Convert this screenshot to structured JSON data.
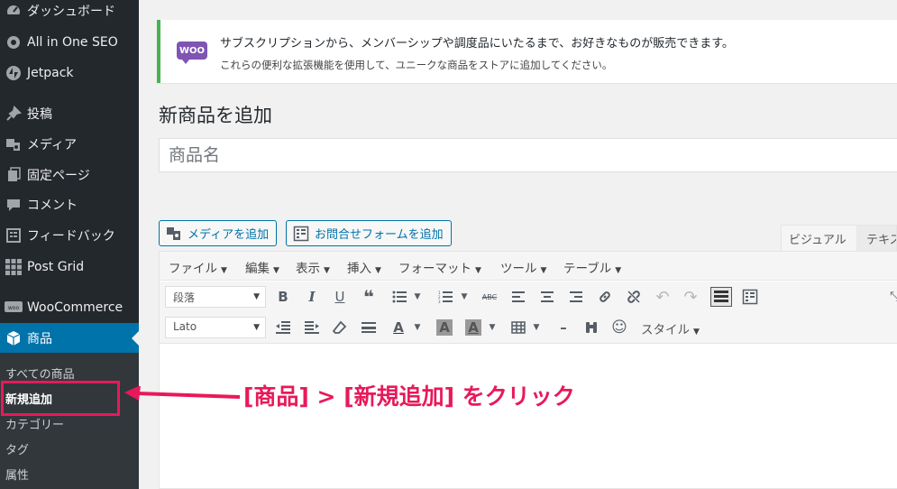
{
  "sidebar": {
    "items": [
      {
        "label": "ダッシュボード",
        "icon": "dashboard-icon"
      },
      {
        "label": "All in One SEO",
        "icon": "gear-icon"
      },
      {
        "label": "Jetpack",
        "icon": "jetpack-icon"
      },
      {
        "label": "投稿",
        "icon": "pin-icon"
      },
      {
        "label": "メディア",
        "icon": "media-icon"
      },
      {
        "label": "固定ページ",
        "icon": "pages-icon"
      },
      {
        "label": "コメント",
        "icon": "comment-icon"
      },
      {
        "label": "フィードバック",
        "icon": "feedback-icon"
      },
      {
        "label": "Post Grid",
        "icon": "grid-icon"
      },
      {
        "label": "WooCommerce",
        "icon": "woocommerce-icon"
      },
      {
        "label": "商品",
        "icon": "product-box-icon",
        "current": true
      }
    ],
    "submenu": [
      "すべての商品",
      "新規追加",
      "カテゴリー",
      "タグ",
      "属性"
    ],
    "active_submenu": "新規追加"
  },
  "notice": {
    "logo": "WOO",
    "line1": "サブスクリプションから、メンバーシップや調度品にいたるまで、お好きなものが販売できます。",
    "line2": "これらの便利な拡張機能を使用して、ユニークな商品をストアに追加してください。"
  },
  "page_title": "新商品を追加",
  "title_input": {
    "placeholder": "商品名",
    "value": ""
  },
  "media_buttons": {
    "add_media": "メディアを追加",
    "add_form": "お問合せフォームを追加"
  },
  "editor_tabs": {
    "visual": "ビジュアル",
    "text": "テキスト"
  },
  "menubar": [
    "ファイル",
    "編集",
    "表示",
    "挿入",
    "フォーマット",
    "ツール",
    "テーブル"
  ],
  "toolbar": {
    "paragraph_select": "段落",
    "font_select": "Lato",
    "styles": "スタイル"
  },
  "annotation": {
    "text": "[商品] > [新規追加] をクリック"
  },
  "colors": {
    "sidebar_bg": "#23282d",
    "current_menu": "#0073aa",
    "notice_border": "#46b450",
    "annotation": "#e8195a"
  }
}
